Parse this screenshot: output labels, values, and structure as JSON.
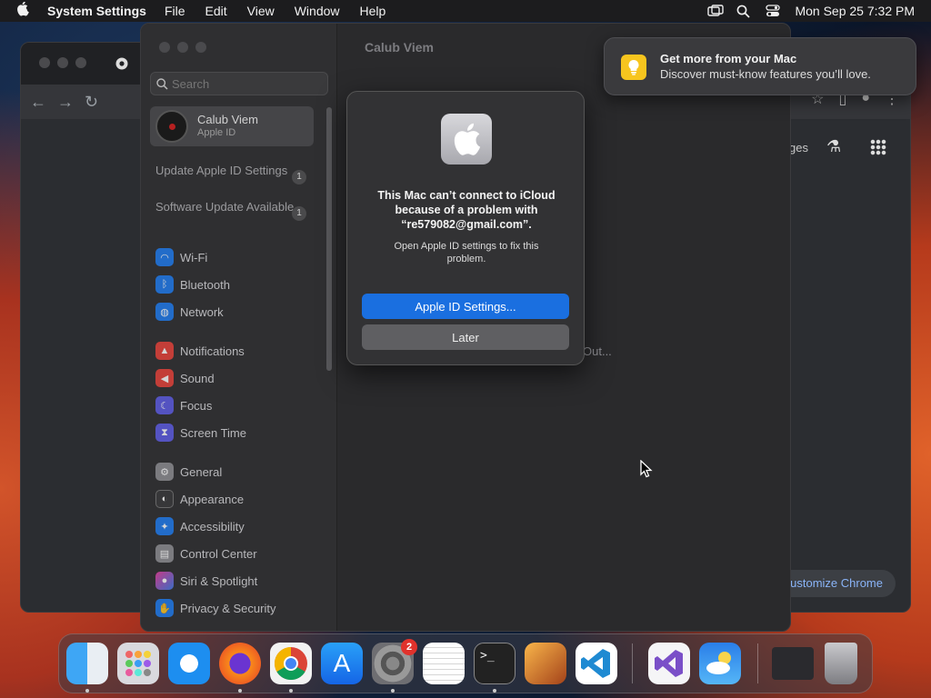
{
  "menubar": {
    "app_name": "System Settings",
    "items": [
      "File",
      "Edit",
      "View",
      "Window",
      "Help"
    ],
    "clock": "Mon Sep 25  7:32 PM"
  },
  "chrome": {
    "partial_ges": "ges",
    "customize_label": "ustomize Chrome"
  },
  "settings": {
    "window_title": "Calub Viem",
    "search_placeholder": "Search",
    "account": {
      "name": "Calub Viem",
      "subtitle": "Apple ID"
    },
    "notices": [
      {
        "label": "Update Apple ID Settings",
        "count": "1"
      },
      {
        "label": "Software Update Available",
        "count": "1"
      }
    ],
    "sidebar_items": [
      {
        "label": "Wi-Fi",
        "icon": "wifi-icon",
        "color": "#1f7cf0"
      },
      {
        "label": "Bluetooth",
        "icon": "bluetooth-icon",
        "color": "#1f7cf0"
      },
      {
        "label": "Network",
        "icon": "globe-icon",
        "color": "#1f7cf0"
      },
      {
        "label": "Notifications",
        "icon": "bell-icon",
        "color": "#e8423a"
      },
      {
        "label": "Sound",
        "icon": "speaker-icon",
        "color": "#e8423a"
      },
      {
        "label": "Focus",
        "icon": "moon-icon",
        "color": "#5e5ce6"
      },
      {
        "label": "Screen Time",
        "icon": "hourglass-icon",
        "color": "#5e5ce6"
      },
      {
        "label": "General",
        "icon": "gear-icon",
        "color": "#8e8e93"
      },
      {
        "label": "Appearance",
        "icon": "appearance-icon",
        "color": "#3a3a3c"
      },
      {
        "label": "Accessibility",
        "icon": "accessibility-icon",
        "color": "#1f7cf0"
      },
      {
        "label": "Control Center",
        "icon": "control-center-icon",
        "color": "#8e8e93"
      },
      {
        "label": "Siri & Spotlight",
        "icon": "siri-icon",
        "color": "#b04ad8"
      },
      {
        "label": "Privacy & Security",
        "icon": "hand-icon",
        "color": "#1f7cf0"
      }
    ],
    "partial_out": "Out..."
  },
  "dialog": {
    "title": "This Mac can’t connect to iCloud because of a problem with “re579082@gmail.com”.",
    "message": "Open Apple ID settings to fix this problem.",
    "primary_button": "Apple ID Settings...",
    "secondary_button": "Later"
  },
  "notification": {
    "title": "Get more from your Mac",
    "body": "Discover must-know features you’ll love."
  },
  "dock": {
    "settings_badge": "2",
    "apps": [
      "finder-icon",
      "launchpad-icon",
      "safari-icon",
      "firefox-icon",
      "chrome-icon",
      "app-store-icon",
      "system-settings-icon",
      "textedit-icon",
      "terminal-icon",
      "garageband-icon",
      "vscode-icon",
      "visual-studio-icon",
      "weather-icon",
      "screenshot-thumbnail",
      "trash-icon"
    ]
  }
}
